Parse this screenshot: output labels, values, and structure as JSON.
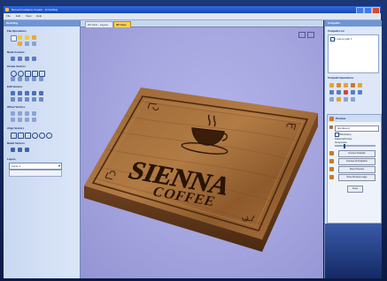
{
  "app": {
    "title": "Bernard Guidance Creator - [C:\\Coffee]",
    "menu": [
      "File",
      "Edit",
      "View",
      "Help"
    ]
  },
  "left_panel": {
    "title": "Modeling",
    "sections": [
      "File Operations",
      "Read Content",
      "Create Vectors",
      "Edit Vectors",
      "Offset Vectors",
      "Align Vectors",
      "Relief Vectors"
    ],
    "layer_label": "Layers",
    "layer_value": "Layer 1"
  },
  "tabs": [
    "2D View - Layout",
    "3D View"
  ],
  "model": {
    "line1": "SIENNA",
    "line2": "COFFEE",
    "wood_colors": [
      "#8a5a2e",
      "#5a3414",
      "#b07a44"
    ]
  },
  "right_panel": {
    "title": "Toolpaths",
    "list_header": "Toolpath List",
    "list_item": "1 Carve path 1",
    "ops_header": "Toolpath Operations",
    "preview_header": "Preview",
    "material": "Hardwood",
    "checkbox_label": "Wireframe",
    "slider_labels": [
      "Material/Cutter",
      "Grayscale"
    ],
    "buttons": [
      "Preview Toolpath",
      "Preview All Toolpaths",
      "Reset Preview",
      "Save Preview Image"
    ],
    "close": "Close"
  },
  "colors": {
    "accent": "#3a6fd8",
    "viewport": "#a4a4df",
    "panel": "#d6e3f7",
    "active_tab": "#ffd24a"
  }
}
